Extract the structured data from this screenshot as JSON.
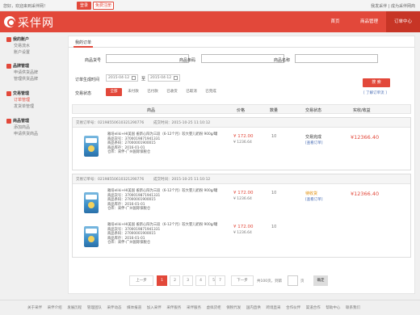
{
  "topbar": {
    "welcome": "您好，欢迎来到采伴网！",
    "login": "登录",
    "register": "免费注册",
    "right_links": "我发采伴 | 成为采伴网商"
  },
  "header": {
    "logo_text": "采伴网",
    "nav": [
      "首页",
      "商品管理",
      "订单中心"
    ]
  },
  "sidebar": {
    "groups": [
      {
        "title": "我的账户",
        "items": [
          "交易流水",
          "账户设置"
        ]
      },
      {
        "title": "品牌管理",
        "items": [
          "申请供货品牌",
          "管理供货品牌"
        ]
      },
      {
        "title": "交易管理",
        "items": [
          "订单管理",
          "发货单管理"
        ]
      },
      {
        "title": "商品管理",
        "items": [
          "添加商品",
          "申请供货商品"
        ]
      }
    ]
  },
  "main": {
    "tab": "我的订单",
    "filters": {
      "goods_no": "商品货号",
      "goods_code": "商品条码",
      "goods_name": "商品名称",
      "order_time": "订单生成时间",
      "date_from": "2015-04-12",
      "to": "至",
      "date_to": "2015-04-12",
      "trade_status": "交易状态",
      "statuses": [
        "全部",
        "未付款",
        "已付款",
        "已收货",
        "已取消",
        "已完成"
      ],
      "search": "搜 索",
      "advanced": "[ 了解订单流 ]"
    },
    "columns": [
      "商品",
      "价格",
      "数量",
      "交易状态",
      "实收/收益"
    ],
    "orders": [
      {
        "no": "交易订单号：02198550610321290776",
        "time": "成交时间：2015-10-25 11:10:12",
        "items": [
          {
            "lines": [
              "雅培eliki+HI美国 雀新心阳为三段（6-12个月）较大婴儿奶粉 900g/罐",
              "商品货号：3700019871941331",
              "商品条码：27000001900015",
              "商品库存：2016-01-01",
              "仓库：采伴-广州国际保税仓"
            ],
            "price": "¥ 172.00",
            "sub": "¥ 1236.64",
            "qty": "10"
          }
        ],
        "status": "交易完成",
        "status_link": "[查看订单]",
        "amount": "¥12366.40"
      },
      {
        "no": "交易订单号：02198550610321290776",
        "time": "成交时间：2015-10-25 11:10:12",
        "items": [
          {
            "lines": [
              "雅培eliki+HI美国 雀新心阳为三段（6-12个月）较大婴儿奶粉 900g/罐",
              "商品货号：3700019871941331",
              "商品条码：27000001900015",
              "商品库存：2016-01-01",
              "仓库：采伴-广州国际保税仓"
            ],
            "price": "¥ 172.00",
            "sub": "¥ 1236.64",
            "qty": "10"
          },
          {
            "lines": [
              "雅培eliki+HI美国 雀新心阳为三段（6-12个月）较大婴儿奶粉 900g/罐",
              "商品货号：3700019871941331",
              "商品条码：27000001900015",
              "商品库存：2016-01-01",
              "仓库：采伴-广州国际保税仓"
            ],
            "price": "¥ 172.00",
            "sub": "¥ 1236.64",
            "qty": "10"
          }
        ],
        "status": "待收货",
        "status_link": "[查看订单]",
        "amount": "¥12366.40"
      }
    ],
    "pager": {
      "prev": "上一步",
      "pages": [
        "1",
        "2",
        "3",
        "4",
        "5",
        "...",
        "7"
      ],
      "next": "下一步",
      "total": "共100页，到第",
      "page_word": "页",
      "ok": "确定"
    }
  },
  "footer": {
    "links": [
      "关于采伴",
      "采伴介绍",
      "发展历程",
      "管理团队",
      "采伴动态",
      "媒体报道",
      "加入采伴",
      "采伴服务",
      "采伴服务",
      "虚拟货柜",
      "保税代发",
      "国内直供",
      "跨境直采",
      "合作伙伴",
      "渠道合作",
      "帮助中心",
      "联系我们"
    ]
  }
}
